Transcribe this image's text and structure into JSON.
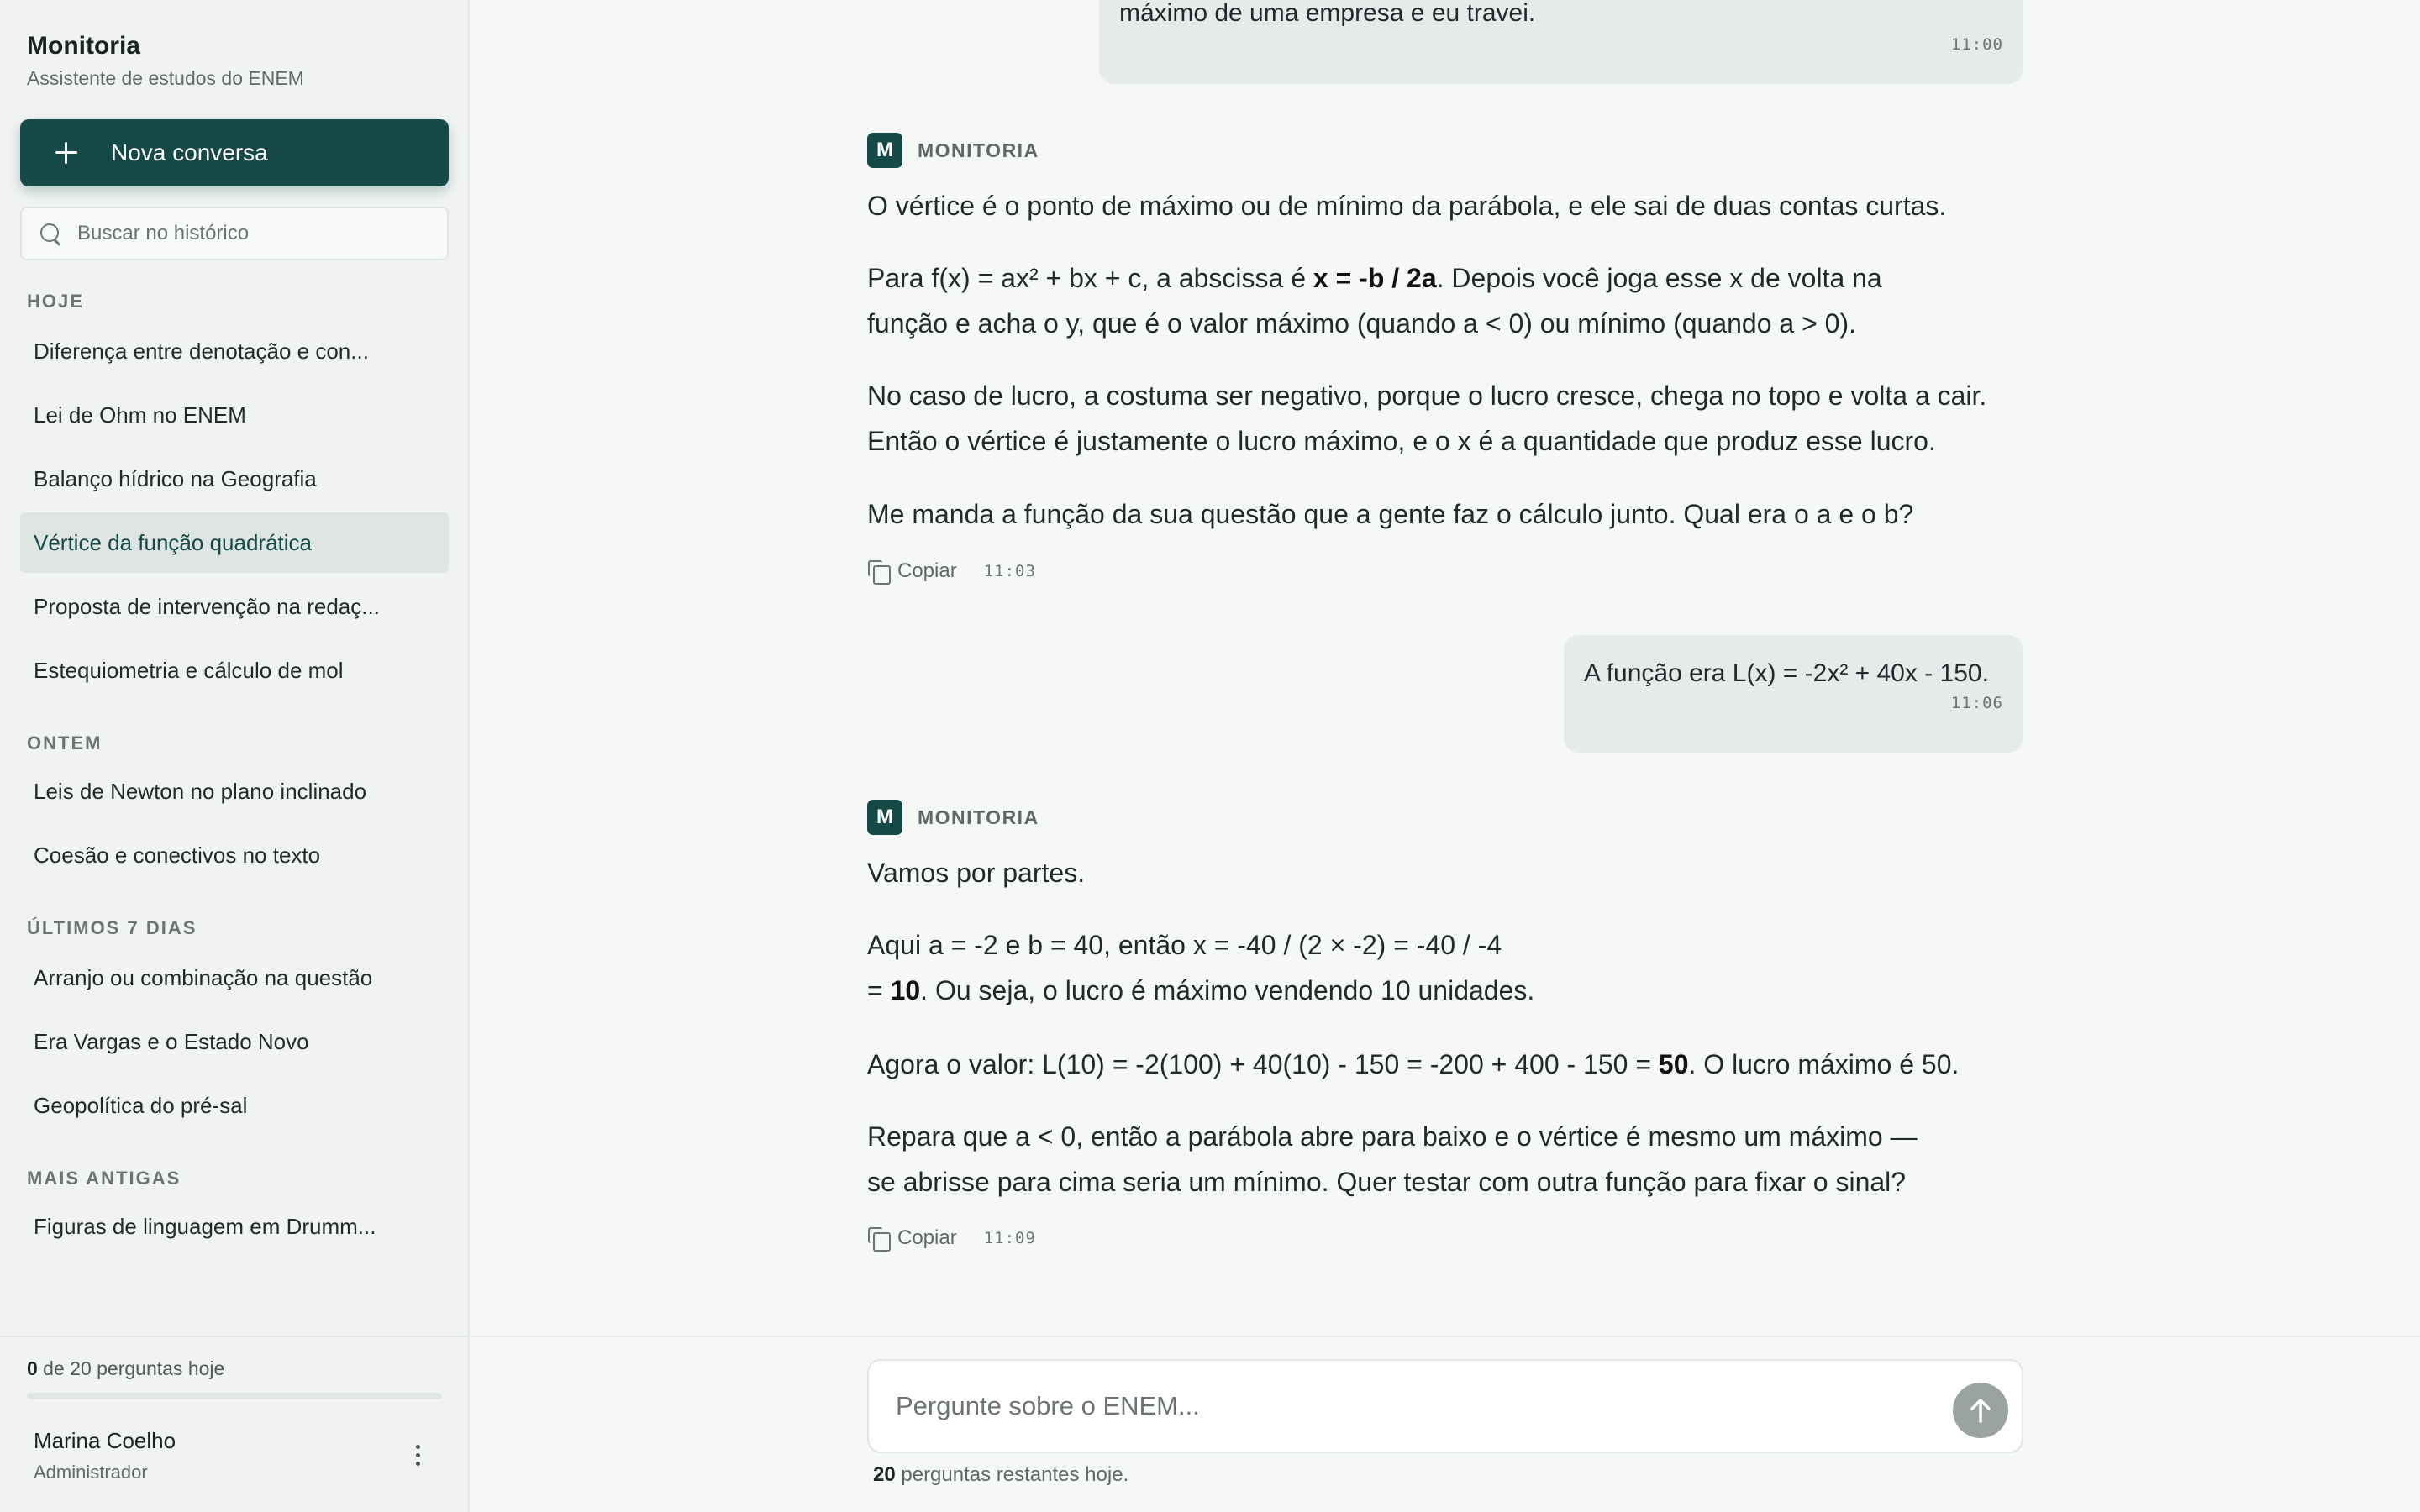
{
  "sidebar": {
    "title": "Monitoria",
    "subtitle": "Assistente de estudos do ENEM",
    "new_chat_label": "Nova conversa",
    "search_placeholder": "Buscar no histórico",
    "sections": {
      "today": "HOJE",
      "yesterday": "ONTEM",
      "last7": "ÚLTIMOS 7 DIAS",
      "older": "MAIS ANTIGAS"
    },
    "today_items": [
      "Diferença entre denotação e con...",
      "Lei de Ohm no ENEM",
      "Balanço hídrico na Geografia",
      "Vértice da função quadrática",
      "Proposta de intervenção na redaç...",
      "Estequiometria e cálculo de mol"
    ],
    "yesterday_items": [
      "Leis de Newton no plano inclinado",
      "Coesão e conectivos no texto"
    ],
    "last7_items": [
      "Arranjo ou combinação na questão",
      "Era Vargas e o Estado Novo",
      "Geopolítica do pré-sal"
    ],
    "older_items": [
      "Figuras de linguagem em Drumm..."
    ],
    "quota_used": "0",
    "quota_text": " de 20 perguntas hoje",
    "quota_fraction": 0,
    "user_name": "Marina Coelho",
    "user_role": "Administrador"
  },
  "chat": {
    "user_msg_1_tail": "máximo de uma empresa e eu travei.",
    "user_msg_1_time": "11:00",
    "bot_name": "MONITORIA",
    "bot_avatar": "M",
    "bot_msg_1": {
      "p1": "O vértice é o ponto de máximo ou de mínimo da parábola, e ele sai de duas contas curtas.",
      "p2_a": "Para f(x) = ax² + bx + c, a abscissa é ",
      "p2_b": "x = -b / 2a",
      "p2_c": ". Depois você joga esse x de volta na",
      "p2_d": "função e acha o y, que é o valor máximo (quando a < 0) ou mínimo (quando a > 0).",
      "p3_a": "No caso de lucro, a costuma ser negativo, porque o lucro cresce, chega no topo e volta a cair.",
      "p3_b": "Então o vértice é justamente o lucro máximo, e o x é a quantidade que produz esse lucro.",
      "p4": "Me manda a função da sua questão que a gente faz o cálculo junto. Qual era o a e o b?",
      "time": "11:03"
    },
    "copy_label": "Copiar",
    "user_msg_2": "A função era L(x) = -2x² + 40x - 150.",
    "user_msg_2_time": "11:06",
    "bot_msg_2": {
      "p1": "Vamos por partes.",
      "p2_a": "Aqui a = -2 e b = 40, então x = -40 / (2 × -2) = -40 / -4",
      "p2_b": "= ",
      "p2_c": "10",
      "p2_d": ". Ou seja, o lucro é máximo vendendo 10 unidades.",
      "p3_a": "Agora o valor: L(10) = -2(100) + 40(10) - 150 = -200 + 400 - 150 = ",
      "p3_b": "50",
      "p3_c": ". O lucro máximo é 50.",
      "p4_a": "Repara que a < 0, então a parábola abre para baixo e o vértice é mesmo um máximo —",
      "p4_b": "se abrisse para cima seria um mínimo. Quer testar com outra função para fixar o sinal?",
      "time": "11:09"
    }
  },
  "composer": {
    "placeholder": "Pergunte sobre o ENEM...",
    "remaining_count": "20",
    "remaining_text": " perguntas restantes hoje."
  },
  "colors": {
    "accent": "#154a48",
    "send_disabled": "#9aa3a1",
    "bubble": "#e6eaea"
  }
}
